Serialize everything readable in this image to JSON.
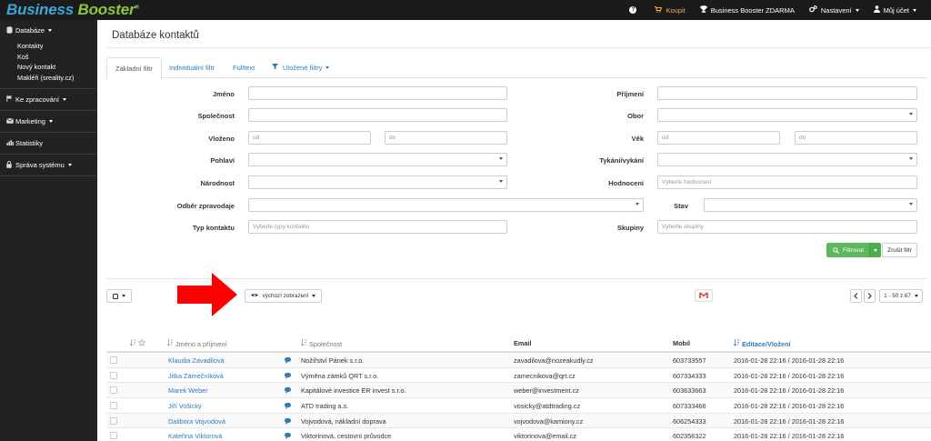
{
  "app": {
    "logo_part1": "Business",
    "logo_part2": "Booster",
    "logo_mark": "®"
  },
  "topnav": {
    "help_icon": "?",
    "buy_label": "Koupit",
    "free_label": "Business Booster ZDARMA",
    "settings_label": "Nastavení",
    "account_label": "Můj účet"
  },
  "sidebar": {
    "databaze": "Databáze",
    "databaze_items": [
      "Kontakty",
      "Koš",
      "Nový kontakt",
      "Makléři (sreality.cz)"
    ],
    "ke_zpracovani": "Ke zpracování",
    "marketing": "Marketing",
    "statistiky": "Statistiky",
    "sprava": "Správa systému"
  },
  "page": {
    "title": "Databáze kontaktů"
  },
  "tabs": {
    "basic": "Základní filtr",
    "individual": "Individuální filtr",
    "fulltext": "Fulltext",
    "saved": "Uložené filtry"
  },
  "filter": {
    "jmeno": "Jméno",
    "prijmeni": "Příjmení",
    "spolecnost": "Společnost",
    "obor": "Obor",
    "vlozeno": "Vloženo",
    "vek": "Věk",
    "od": "od",
    "do": "do",
    "pohlavi": "Pohlaví",
    "tykani": "Tykání/vykání",
    "narodnost": "Národnost",
    "hodnoceni": "Hodnocení",
    "hodnoceni_ph": "Vyberte hodnocení",
    "odber": "Odběr zpravodaje",
    "stav": "Stav",
    "typ": "Typ kontaktu",
    "typ_ph": "Vyberte typy kontaktu",
    "skupiny": "Skupiny",
    "skupiny_ph": "Vyberte skupiny",
    "btn_filter": "Filtrovat",
    "btn_reset": "Zrušit filtr"
  },
  "toolbar": {
    "view_label": "výchozí zobrazení",
    "pager_info": "1 - 50 z 67"
  },
  "table": {
    "headers": {
      "name": "Jméno a příjmení",
      "company": "Společnost",
      "email": "Email",
      "mobile": "Mobil",
      "edited": "Editace/Vložení"
    },
    "rows": [
      {
        "name": "Klaudia Zavadilová",
        "company": "Nožířství Pánek s.r.o.",
        "email": "zavadilova@nozeakudly.cz",
        "mobile": "603733557",
        "edited": "2016-01-28 22:16 / 2016-01-28 22:16"
      },
      {
        "name": "Jitka Zámečníková",
        "company": "Výměna zámků QRT s.r.o.",
        "email": "zamecnikova@qrt.cz",
        "mobile": "607334333",
        "edited": "2016-01-28 22:16 / 2016-01-28 22:16"
      },
      {
        "name": "Marek Weber",
        "company": "Kapitálové investice ER invest s.r.o.",
        "email": "weber@investment.cz",
        "mobile": "603633663",
        "edited": "2016-01-28 22:16 / 2016-01-28 22:16"
      },
      {
        "name": "Jiří Vošický",
        "company": "ATD trading a.s.",
        "email": "vosicky@atdtrading.cz",
        "mobile": "607333466",
        "edited": "2016-01-28 22:16 / 2016-01-28 22:16"
      },
      {
        "name": "Dalibora Vojvodová",
        "company": "Vojvodová, nákladní doprava",
        "email": "vojvodova@kamiony.cz",
        "mobile": "606254333",
        "edited": "2016-01-28 22:16 / 2016-01-28 22:16"
      },
      {
        "name": "Kateřina Viktorová",
        "company": "Viktorinová, cestovní průvodce",
        "email": "viktorinova@email.cz",
        "mobile": "602356322",
        "edited": "2016-01-28 22:16 / 2016-01-28 22:16"
      }
    ]
  }
}
